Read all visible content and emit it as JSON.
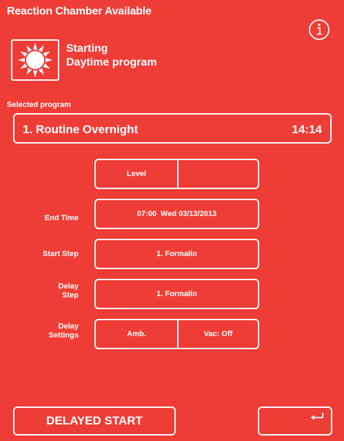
{
  "header": {
    "title": "Reaction Chamber Available",
    "info_icon": "info-circle-icon"
  },
  "status": {
    "icon": "sun-icon",
    "line1": "Starting",
    "line2": "Daytime program"
  },
  "selected_program": {
    "label": "Selected program",
    "name": "1. Routine Overnight",
    "time": "14:14"
  },
  "settings": {
    "level": {
      "label": "Level",
      "value": ""
    },
    "end_time": {
      "label": "End Time",
      "value": "07:00  Wed 03/13/2013"
    },
    "start_step": {
      "label": "Start Step",
      "value": "1. Formalin"
    },
    "delay_step": {
      "label_line1": "Delay",
      "label_line2": "Step",
      "value": "1. Formalin"
    },
    "delay_settings": {
      "label_line1": "Delay",
      "label_line2": "Settings",
      "temp": "Amb.",
      "vac": "Vac: Off"
    }
  },
  "footer": {
    "delayed_start_label": "DELAYED START",
    "back_icon": "return-arrow-icon"
  },
  "colors": {
    "background": "#ee3d36",
    "foreground": "#ffffff"
  }
}
